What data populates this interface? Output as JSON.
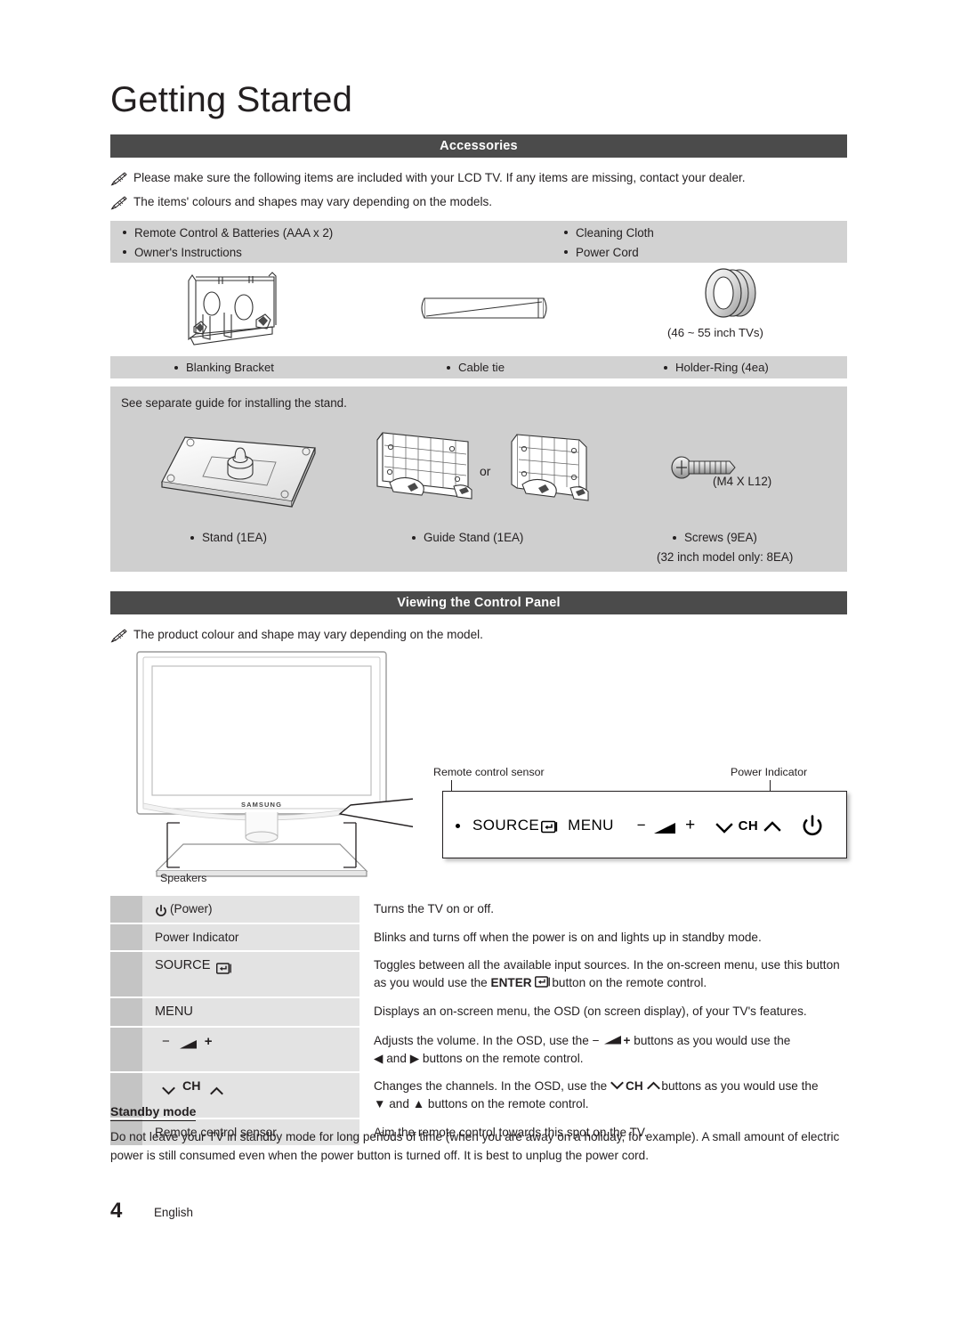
{
  "page": {
    "title": "Getting Started",
    "footer_number": "4",
    "footer_language": "English"
  },
  "accessories": {
    "bar_label": "Accessories",
    "notes": [
      "Please make sure the following items are included with your LCD TV. If any items are missing, contact your dealer.",
      "The items' colours and shapes may vary depending on the models."
    ],
    "list_left": [
      "Remote Control & Batteries (AAA x 2)",
      "Owner's Instructions"
    ],
    "list_right": [
      "Cleaning Cloth",
      "Power Cord"
    ],
    "figure_labels": {
      "blanking_bracket": "Blanking Bracket",
      "cable_tie": "Cable tie",
      "holder_ring": "Holder-Ring (4ea)",
      "holder_ring_note": "(46 ~ 55 inch TVs)"
    },
    "stand_section": {
      "guide_text": "See separate guide for installing the stand.",
      "or_label": "or",
      "screw_spec": "(M4 X L12)",
      "stand_label": "Stand (1EA)",
      "guide_stand_label": "Guide Stand (1EA)",
      "screws_label": "Screws (9EA)",
      "screws_note": "(32 inch model only: 8EA)"
    }
  },
  "control_panel": {
    "bar_label": "Viewing the Control Panel",
    "note": "The product colour and shape may vary depending on the model.",
    "tv_brand": "SAMSUNG",
    "speakers_label": "Speakers",
    "sensor_label": "Remote control sensor",
    "power_indicator_label": "Power Indicator",
    "panel_buttons": {
      "source": "SOURCE",
      "menu": "MENU",
      "minus": "−",
      "plus": "+",
      "ch": "CH"
    },
    "table": [
      {
        "label": "(Power)",
        "icon": "power-icon",
        "desc": "Turns the TV on or off."
      },
      {
        "label": "Power Indicator",
        "icon": "",
        "desc": "Blinks and turns off when the power is on and lights up in standby mode."
      },
      {
        "label": "SOURCE",
        "icon": "enter-icon",
        "desc_part1": "Toggles between all the available input sources. In the on-screen menu, use this button as you would use the ",
        "desc_strong": "ENTER",
        "desc_part2": " button on the remote control."
      },
      {
        "label": "MENU",
        "icon": "",
        "desc": "Displays an on-screen menu, the OSD (on screen display), of your TV's features."
      },
      {
        "label": "",
        "icon": "volume-icon",
        "desc_part1": "Adjusts the volume. In the OSD, use the ",
        "desc_part2": " buttons as you would use the ",
        "desc_part3": "◀ and ▶ buttons on the remote control."
      },
      {
        "label": "CH",
        "icon": "channel-icon",
        "desc_part1": "Changes the channels. In the OSD, use the ",
        "desc_part2": " buttons as you would use the ",
        "desc_part3": "▼ and ▲ buttons on the remote control."
      },
      {
        "label": "Remote control sensor",
        "icon": "",
        "desc": "Aim the remote control towards this spot on the TV."
      }
    ]
  },
  "standby": {
    "title": "Standby mode",
    "body": "Do not leave your TV in standby mode for long periods of time (when you are away on a holiday, for example). A small amount of electric power is still consumed even when the power button is turned off. It is best to unplug the power cord."
  },
  "colors": {
    "section_bar": "#4b4b4b",
    "band_gray": "#d2d2d2",
    "panel_gray": "#cfcfcf",
    "table_label_gray": "#e3e3e3",
    "table_bar_gray": "#c4c4c4",
    "text": "#231f20"
  }
}
